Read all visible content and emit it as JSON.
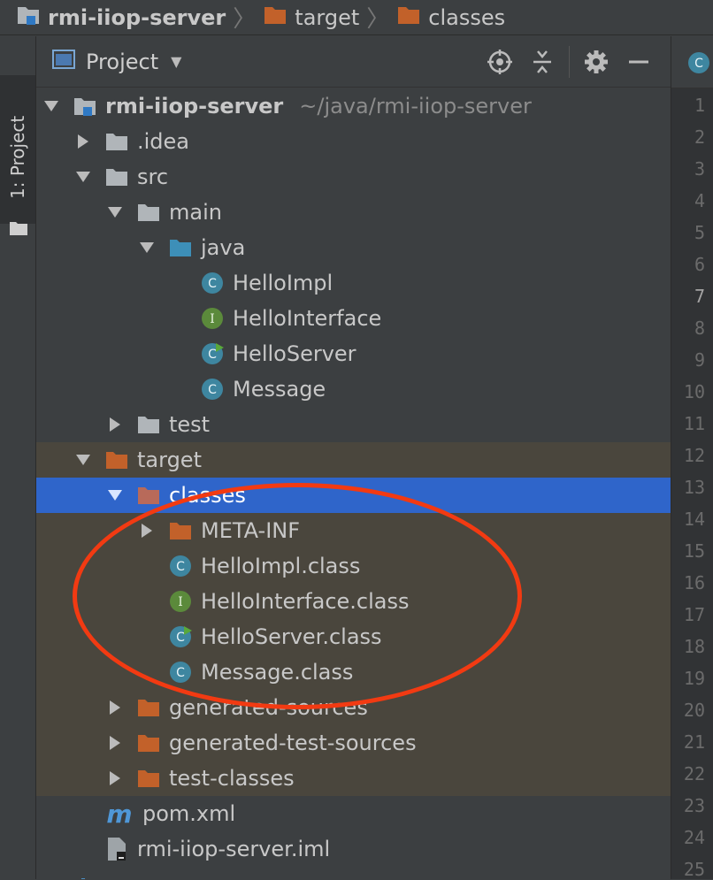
{
  "breadcrumb": {
    "items": [
      {
        "label": "rmi-iiop-server",
        "icon": "module-folder-icon"
      },
      {
        "label": "target",
        "icon": "folder-icon"
      },
      {
        "label": "classes",
        "icon": "folder-icon"
      }
    ]
  },
  "left_strip": {
    "tab_label": "1: Project"
  },
  "panel": {
    "title": "Project",
    "icons": [
      "locate-icon",
      "collapse-all-icon",
      "gear-icon",
      "hide-icon"
    ]
  },
  "tree": {
    "root_label": "rmi-iiop-server",
    "root_path": "~/java/rmi-iiop-server",
    "idea": ".idea",
    "src": "src",
    "main": "main",
    "java": "java",
    "src_classes": [
      "HelloImpl",
      "HelloInterface",
      "HelloServer",
      "Message"
    ],
    "test": "test",
    "target": "target",
    "classes": "classes",
    "meta_inf": "META-INF",
    "class_files": [
      "HelloImpl.class",
      "HelloInterface.class",
      "HelloServer.class",
      "Message.class"
    ],
    "generated_sources": "generated-sources",
    "generated_test_sources": "generated-test-sources",
    "test_classes": "test-classes",
    "pom": "pom.xml",
    "pom_glyph": "m",
    "iml": "rmi-iiop-server.iml"
  },
  "gutter": {
    "line_numbers": [
      "1",
      "2",
      "3",
      "4",
      "5",
      "6",
      "7",
      "8",
      "9",
      "10",
      "11",
      "12",
      "13",
      "14",
      "15",
      "16",
      "17",
      "18",
      "19",
      "20",
      "21",
      "22",
      "23",
      "24",
      "25"
    ],
    "active_line": "7"
  },
  "colors": {
    "background": "#3c3f41",
    "selection": "#2f65ca",
    "excluded": "#4a463d",
    "folder": "#b0b5b9",
    "excluded_folder": "#c2612a",
    "source_folder": "#3d8fb8",
    "class_icon": "#3e86a0",
    "interface_icon": "#5b8a3b",
    "annotation": "#f23a12"
  }
}
